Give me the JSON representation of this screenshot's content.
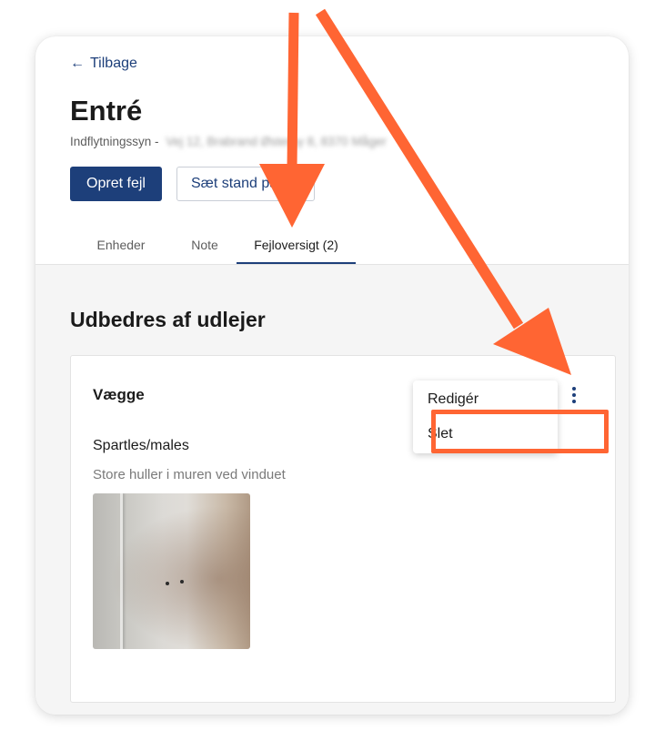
{
  "nav": {
    "back_label": "Tilbage"
  },
  "page": {
    "title": "Entré",
    "subtitle_prefix": "Indflytningssyn -",
    "subtitle_redacted": "Vej 12, Brabrand Østerby 8, 8370 Måger"
  },
  "actions": {
    "primary_label": "Opret fejl",
    "secondary_label": "Sæt stand på"
  },
  "tabs": [
    {
      "label": "Enheder",
      "active": false
    },
    {
      "label": "Note",
      "active": false
    },
    {
      "label": "Fejloversigt (2)",
      "active": true
    }
  ],
  "section": {
    "title": "Udbedres af udlejer",
    "item": {
      "title": "Vægge",
      "defect_title": "Spartles/males",
      "defect_description": "Store huller i muren ved vinduet",
      "icons": [
        "camera-add-icon",
        "more-vertical-icon"
      ]
    }
  },
  "menu": {
    "items": [
      {
        "label": "Redigér"
      },
      {
        "label": "Slet"
      }
    ]
  },
  "colors": {
    "primary": "#1d3f7a",
    "annotation": "#ff6533",
    "background_gray": "#f5f5f5"
  }
}
